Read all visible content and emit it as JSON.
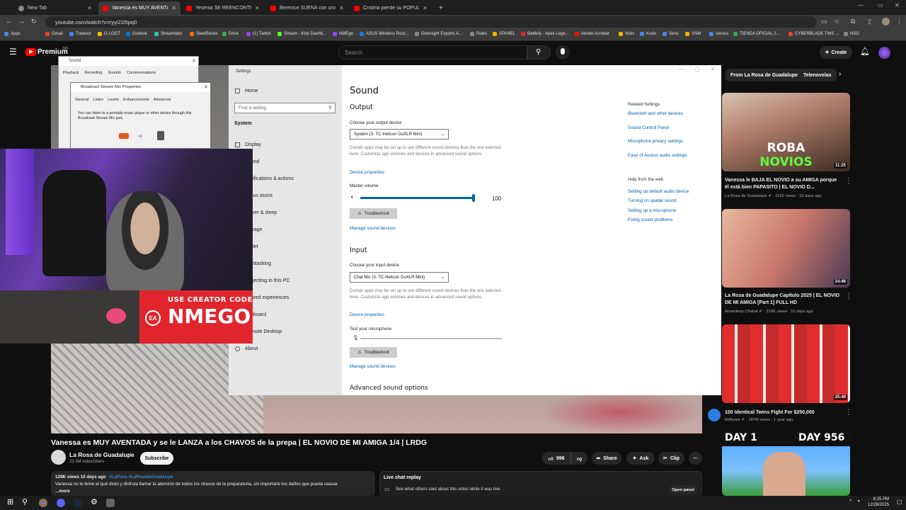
{
  "browser": {
    "tabs": [
      {
        "title": "New Tab"
      },
      {
        "title": "Vanessa es MUY AVENTADA y se l"
      },
      {
        "title": "Yesenia SE REENCONTRÓ con su"
      },
      {
        "title": "Berenice SUEÑA con una lujosa"
      },
      {
        "title": "Cristina pierde su POPULARIDAD"
      }
    ],
    "new_tab": "+",
    "url": "youtube.com/watch?v=ryyi22i5pq0",
    "bookmarks": [
      "Apps",
      "Gmail",
      "Traducir",
      "G-LOOT",
      "Outlook",
      "Streamlabs",
      "SteelSeries",
      "Drive",
      "(1) Twitch",
      "Stream - Kick Dashb...",
      "NMEgo",
      "ASUS Wireless Rout...",
      "Oversight Esports A...",
      "Rules",
      "XPANEL",
      "Battlefy - Apex Lege...",
      "Adobe Acrobat",
      "Vods",
      "Kudo",
      "Sens",
      "VNM",
      "Versus",
      "TIENDA OFICIAL 2...",
      "CYBERBLADE TWS ...",
      "NSG"
    ]
  },
  "youtube": {
    "logo": "Premium",
    "logo_badge": "MX",
    "search_placeholder": "Search",
    "create_label": "Create",
    "video_title": "Vanessa es MUY AVENTADA y se le LANZA a los CHAVOS de la prepa | EL NOVIO DE MI AMIGA 1/4 | LRDG",
    "channel": {
      "name": "La Rosa de Guadalupe",
      "subs": "23.3M subscribers",
      "subscribe": "Subscribe"
    },
    "actions": {
      "likes": "996",
      "share": "Share",
      "ask": "Ask",
      "clip": "Clip"
    },
    "description": {
      "meta": "129K views  10 days ago",
      "tags": "#LaRosa #LaRosadeGuadalupe",
      "text": "Vanessa no le teme al qué dirán y disfruta llamar la atención de todos los chavos de la preparatoria, sin importarle los daños que pueda causar.",
      "more": "...more"
    },
    "live_chat": {
      "title": "Live chat replay",
      "subtitle": "See what others said about this video while it was live.",
      "button": "Open panel"
    },
    "chips": [
      "From La Rosa de Guadalupe",
      "Telenovelas"
    ],
    "recommendations": [
      {
        "title": "Vanessa le BAJA EL NOVIO a su AMIGA porque él está bien PAPASITO | EL NOVIO D...",
        "channel": "La Rosa de Guadalupe",
        "meta": "111K views · 10 days ago",
        "duration": "11:25",
        "overlay_top": "ROBA",
        "overlay_bottom": "NOVIOS"
      },
      {
        "title": "La Rosa de Guadalupe Capítulo 2025 | EL NOVIO DE MI AMIGA [Part 1] FULL HD",
        "channel": "Amardeep Chahal",
        "meta": "319K views · 10 days ago",
        "duration": "24:46"
      },
      {
        "title": "100 Identical Twins Fight For $250,000",
        "channel": "MrBeast",
        "meta": "187M views · 1 year ago",
        "duration": "35:40"
      },
      {
        "overlay_left": "DAY 1",
        "overlay_right": "DAY 956"
      }
    ]
  },
  "sound_dialog": {
    "title": "Sound",
    "tabs": [
      "Playback",
      "Recording",
      "Sounds",
      "Communications"
    ],
    "sub_title": "Broadcast Stream Mix Properties",
    "sub_tabs": [
      "General",
      "Listen",
      "Levels",
      "Enhancements",
      "Advanced"
    ],
    "sub_text": "You can listen to a portable music player or other device through this Broadcast Stream Mix jack."
  },
  "settings": {
    "window_label": "Settings",
    "home": "Home",
    "find_placeholder": "Find a setting",
    "category": "System",
    "nav": [
      "Display",
      "Sound",
      "Notifications & actions",
      "Focus assist",
      "Power & sleep",
      "Storage",
      "Tablet",
      "Multitasking",
      "Projecting to this PC",
      "Shared experiences",
      "Clipboard",
      "Remote Desktop",
      "About"
    ],
    "page_title": "Sound",
    "output": {
      "heading": "Output",
      "device_label": "Choose your output device",
      "device_value": "System (3- TC-Helicon GoXLR Mini)",
      "note": "Certain apps may be set up to use different sound devices than the one selected here. Customize app volumes and devices in advanced sound options.",
      "device_props": "Device properties",
      "volume_label": "Master volume",
      "volume_value": "100",
      "volume_level": 100,
      "troubleshoot": "Troubleshoot",
      "manage": "Manage sound devices"
    },
    "input": {
      "heading": "Input",
      "device_label": "Choose your input device",
      "device_value": "Chat Mic (3- TC-Helicon GoXLR Mini)",
      "note": "Certain apps may be set up to use different sound devices than the one selected here. Customize app volumes and devices in advanced sound options.",
      "device_props": "Device properties",
      "test_label": "Test your microphone",
      "mic_level": 0,
      "troubleshoot": "Troubleshoot",
      "manage": "Manage sound devices"
    },
    "advanced": "Advanced sound options",
    "related": {
      "heading": "Related Settings",
      "links": [
        "Bluetooth and other devices",
        "Sound Control Panel",
        "Microphone privacy settings",
        "Ease of Access audio settings"
      ]
    },
    "help": {
      "heading": "Help from the web",
      "links": [
        "Setting up default audio device",
        "Turning on spatial sound",
        "Setting up a microphone",
        "Fixing sound problems"
      ]
    }
  },
  "overlay": {
    "code_label": "USE CREATOR CODE",
    "code": "NMEGO",
    "brand": "EA"
  },
  "taskbar": {
    "time": "6:25 PM",
    "date": "12/28/2025"
  },
  "colors": {
    "yt_red": "#ff0000",
    "link_blue": "#0063b1",
    "banner_red": "#e0262c"
  }
}
